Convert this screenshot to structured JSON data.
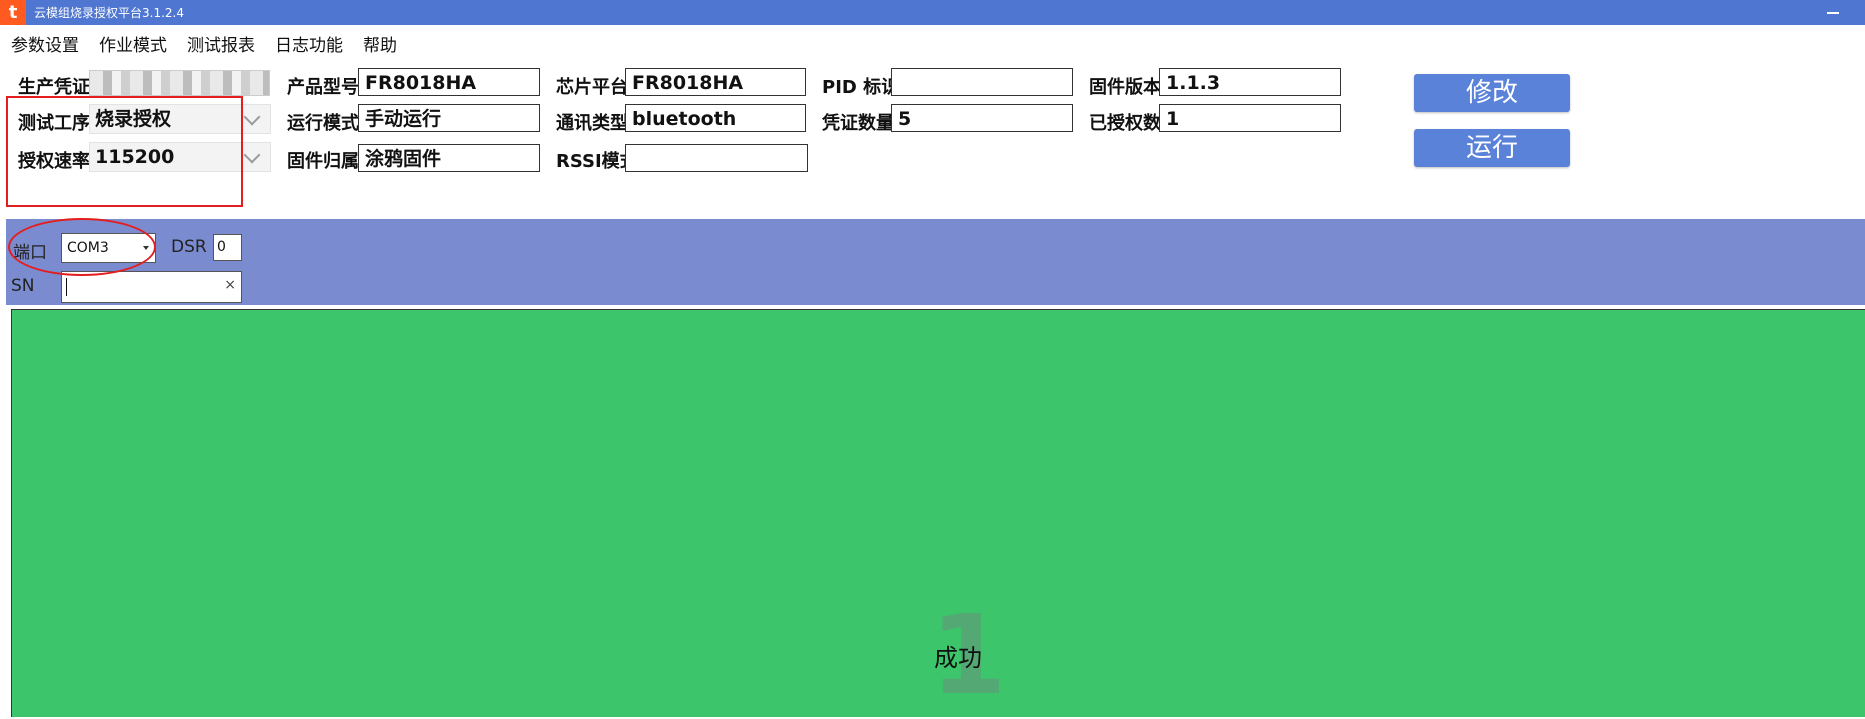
{
  "window": {
    "title": "云模组烧录授权平台3.1.2.4",
    "logo_glyph": "t"
  },
  "menu": [
    "参数设置",
    "作业模式",
    "测试报表",
    "日志功能",
    "帮助"
  ],
  "fields": {
    "production_credential": {
      "label": "生产凭证:"
    },
    "product_model": {
      "label": "产品型号:",
      "value": "FR8018HA"
    },
    "chip_platform": {
      "label": "芯片平台:",
      "value": "FR8018HA"
    },
    "pid": {
      "label": "PID 标识:",
      "value": ""
    },
    "firmware_version": {
      "label": "固件版本:",
      "value": "1.1.3"
    },
    "test_process": {
      "label": "测试工序:",
      "value": "烧录授权"
    },
    "run_mode": {
      "label": "运行模式:",
      "value": "手动运行"
    },
    "comm_type": {
      "label": "通讯类型:",
      "value": "bluetooth"
    },
    "credential_count": {
      "label": "凭证数量:",
      "value": "5"
    },
    "authorized_count": {
      "label": "已授权数:",
      "value": "1"
    },
    "auth_rate": {
      "label": "授权速率:",
      "value": "115200"
    },
    "firmware_owner": {
      "label": "固件归属:",
      "value": "涂鸦固件"
    },
    "rssi_mode": {
      "label": "RSSI模式",
      "value": ""
    }
  },
  "buttons": {
    "modify": "修改",
    "run": "运行"
  },
  "panel": {
    "port_label": "端口",
    "port_value": "COM3",
    "dsr_label": "DSR",
    "dsr_value": "0",
    "sn_label": "SN",
    "sn_value": ""
  },
  "status": {
    "ghost_number": "1",
    "text": "成功",
    "color": "#3cc56b"
  },
  "colors": {
    "titlebar": "#4f77d2",
    "button": "#5a82d9",
    "panel": "#7b8bcf",
    "annotation": "#e41e1e"
  }
}
